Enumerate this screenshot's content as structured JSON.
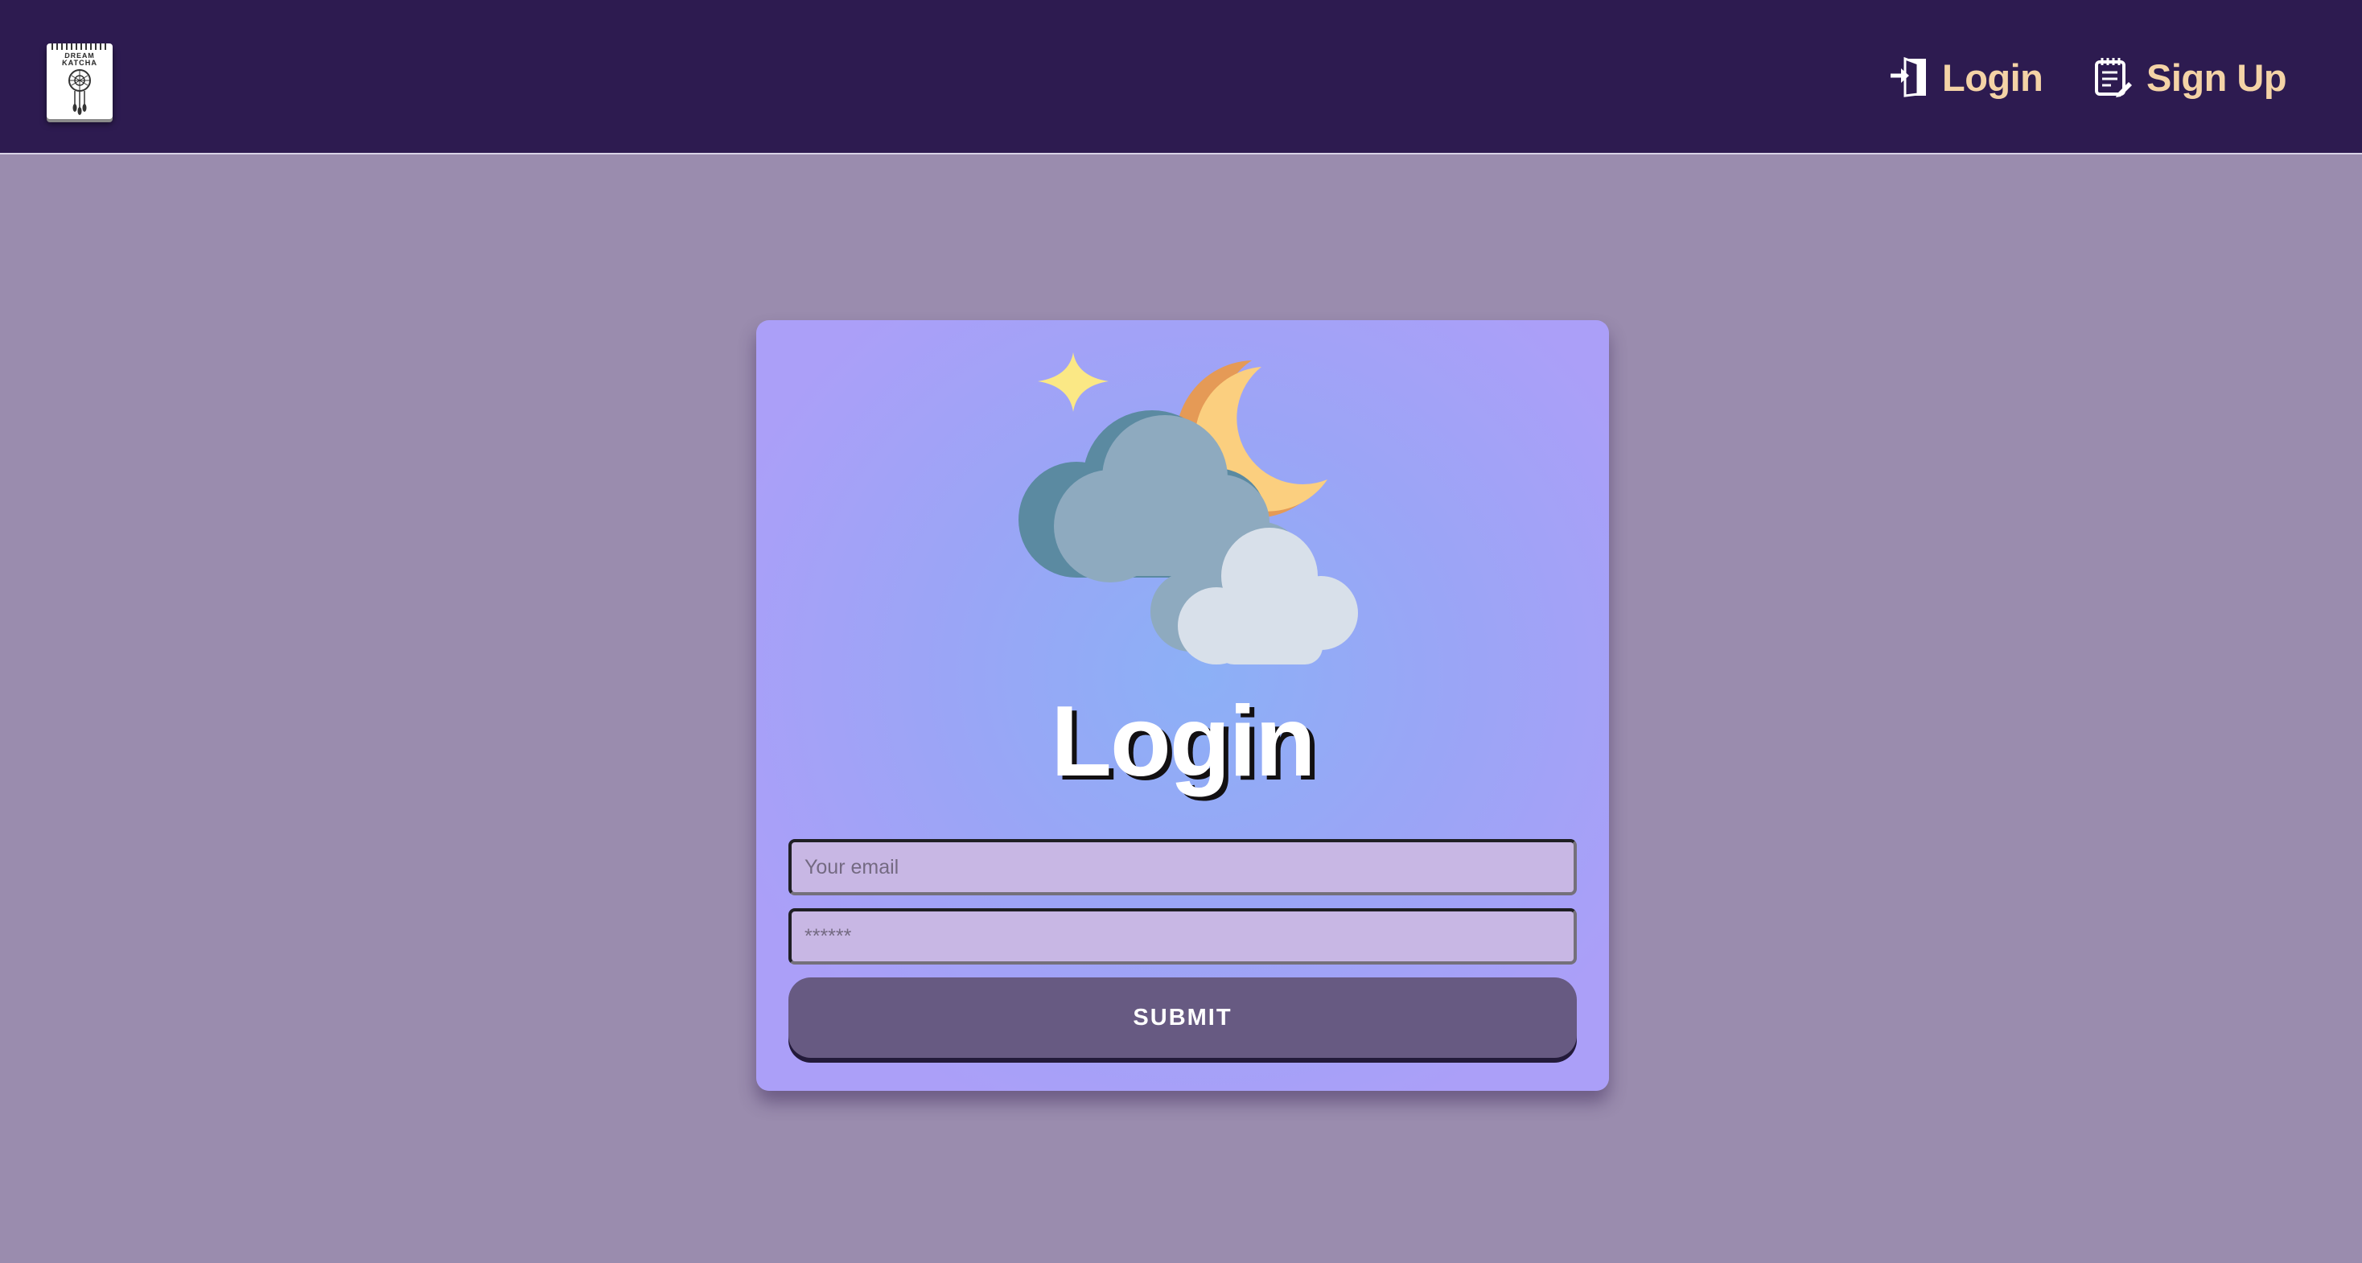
{
  "header": {
    "logo_text": "DREAM KATCHA",
    "nav": {
      "login_label": "Login",
      "signup_label": "Sign Up"
    },
    "icons": [
      "login-door-icon",
      "signup-notepad-icon"
    ]
  },
  "login_form": {
    "title": "Login",
    "illustration": "night-cloud-moon-star-icon",
    "email_placeholder": "Your email",
    "password_placeholder": "******",
    "submit_label": "SUBMIT"
  },
  "colors": {
    "navbar": "#2d1b50",
    "nav_text": "#f4d3a6",
    "page_background": "#9a8cae",
    "card_gradient_center": "#8cb0f6",
    "card_gradient_edge": "#ab9ff8",
    "input_background": "#c8b7e4",
    "submit_background": "#675a82"
  }
}
